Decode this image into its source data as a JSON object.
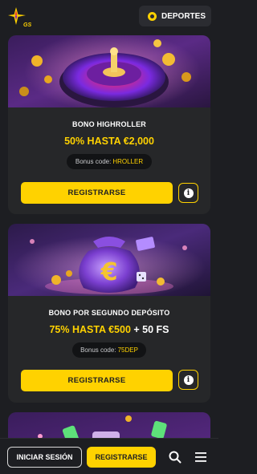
{
  "header": {
    "logo_text": "GS",
    "sports_label": "DEPORTES"
  },
  "promotions": [
    {
      "title": "BONO HIGHROLLER",
      "offer_highlight": "50% HASTA €2,000",
      "offer_rest": "",
      "code_label": "Bonus code:",
      "code_value": "HROLLER",
      "register_label": "REGISTRARSE"
    },
    {
      "title": "BONO POR SEGUNDO DEPÓSITO",
      "offer_highlight": "75% HASTA €500",
      "offer_rest": "+ 50 FS",
      "code_label": "Bonus code:",
      "code_value": "75DEP",
      "register_label": "REGISTRARSE"
    }
  ],
  "bottom_bar": {
    "login_label": "INICIAR SESIÓN",
    "register_label": "REGISTRARSE"
  },
  "icons": {
    "logo": "star-logo-icon",
    "sports": "soccer-ball-icon",
    "info": "info-icon",
    "search": "search-icon",
    "menu": "hamburger-menu-icon"
  },
  "colors": {
    "accent": "#ffd200",
    "background": "#1d1e22",
    "card": "#262729"
  }
}
